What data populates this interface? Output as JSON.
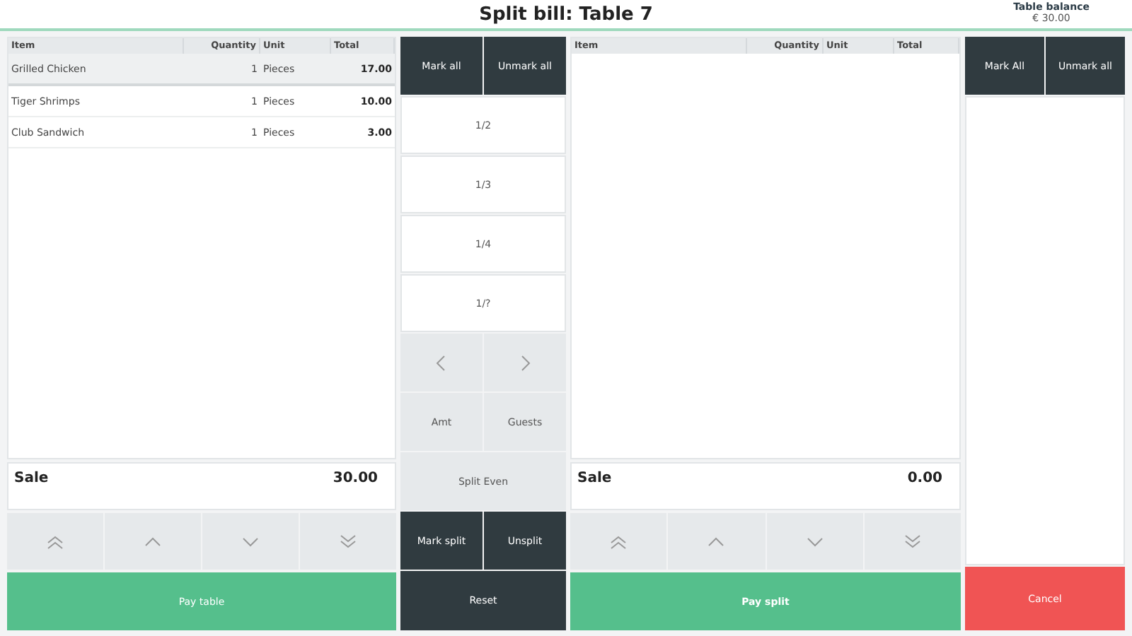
{
  "header": {
    "title": "Split bill: Table 7",
    "balance_label": "Table balance",
    "balance_value": "€ 30.00"
  },
  "bill": {
    "columns": [
      "Item",
      "Quantity",
      "Unit",
      "Total"
    ],
    "rows": [
      {
        "item": "Grilled Chicken",
        "quantity": "1",
        "unit": "Pieces",
        "total": "17.00",
        "selected": true
      },
      {
        "item": "Tiger Shrimps",
        "quantity": "1",
        "unit": "Pieces",
        "total": "10.00",
        "selected": false
      },
      {
        "item": "Club Sandwich",
        "quantity": "1",
        "unit": "Pieces",
        "total": "3.00",
        "selected": false
      }
    ],
    "sale_label": "Sale",
    "sale_value": "30.00",
    "pay": {
      "label": "Pay table",
      "bold": false
    }
  },
  "middle": {
    "mark_all": "Mark all",
    "unmark_all": "Unmark all",
    "fractions": [
      "1/2",
      "1/3",
      "1/4",
      "1/?"
    ],
    "amt": "Amt",
    "guests": "Guests",
    "split_even": "Split Even",
    "mark_split": "Mark split",
    "unsplit": "Unsplit",
    "reset": "Reset"
  },
  "split": {
    "columns": [
      "Item",
      "Quantity",
      "Unit",
      "Total"
    ],
    "sale_label": "Sale",
    "sale_value": "0.00",
    "pay": {
      "label": "Pay split",
      "bold": true
    }
  },
  "right": {
    "mark_all": "Mark All",
    "unmark_all": "Unmark all",
    "cancel": "Cancel"
  }
}
